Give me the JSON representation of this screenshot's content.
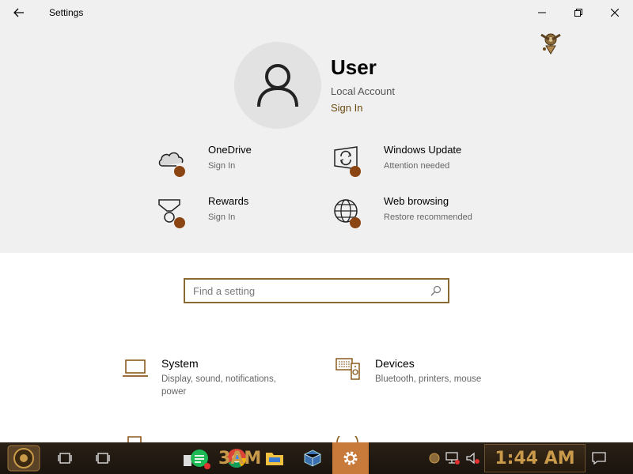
{
  "window": {
    "title": "Settings"
  },
  "profile": {
    "name": "User",
    "account_type": "Local Account",
    "sign_in": "Sign In"
  },
  "quick_tiles": [
    {
      "title": "OneDrive",
      "subtitle": "Sign In",
      "icon": "onedrive-icon"
    },
    {
      "title": "Windows Update",
      "subtitle": "Attention needed",
      "icon": "windows-update-icon"
    },
    {
      "title": "Rewards",
      "subtitle": "Sign In",
      "icon": "rewards-icon"
    },
    {
      "title": "Web browsing",
      "subtitle": "Restore recommended",
      "icon": "web-browsing-icon"
    }
  ],
  "search": {
    "placeholder": "Find a setting",
    "value": ""
  },
  "categories": [
    {
      "title": "System",
      "subtitle": "Display, sound, notifications, power",
      "icon": "laptop-icon"
    },
    {
      "title": "Devices",
      "subtitle": "Bluetooth, printers, mouse",
      "icon": "devices-icon"
    }
  ],
  "taskbar": {
    "clock": "1:44 AM",
    "partial_text": "3AM"
  },
  "colors": {
    "accent": "#6b4a10",
    "badge": "#8b4513",
    "header_bg": "#f0f0f0",
    "search_border": "#8a6a2e",
    "clock_text": "#c89a4a"
  }
}
